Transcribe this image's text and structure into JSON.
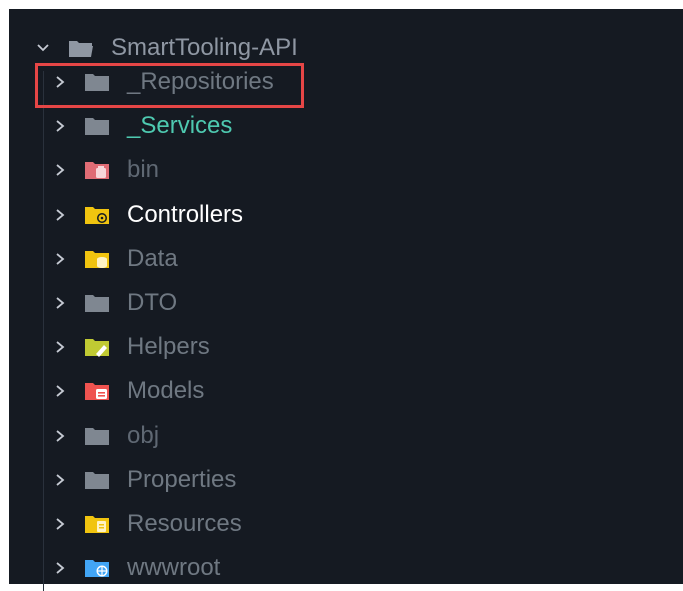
{
  "explorer": {
    "root": {
      "label": "SmartTooling-API",
      "expanded": true,
      "icon": "folder-open-icon",
      "color": "#8f97a3"
    },
    "folders": [
      {
        "id": "repositories",
        "label": "_Repositories",
        "color": "#6f7882",
        "icon_color": "#7f8791",
        "icon": "folder-icon",
        "highlighted": true
      },
      {
        "id": "services",
        "label": "_Services",
        "color": "#4ec9b0",
        "icon_color": "#7f8791",
        "icon": "folder-icon"
      },
      {
        "id": "bin",
        "label": "bin",
        "color": "#5f6873",
        "icon_color": "#e06c75",
        "icon": "folder-bin-icon"
      },
      {
        "id": "controllers",
        "label": "Controllers",
        "color": "#ffffff",
        "icon_color": "#f1c40f",
        "icon": "folder-controllers-icon"
      },
      {
        "id": "data",
        "label": "Data",
        "color": "#6f7882",
        "icon_color": "#f1c40f",
        "icon": "folder-database-icon"
      },
      {
        "id": "dto",
        "label": "DTO",
        "color": "#6f7882",
        "icon_color": "#7f8791",
        "icon": "folder-icon"
      },
      {
        "id": "helpers",
        "label": "Helpers",
        "color": "#6f7882",
        "icon_color": "#c0ca33",
        "icon": "folder-helper-icon"
      },
      {
        "id": "models",
        "label": "Models",
        "color": "#6f7882",
        "icon_color": "#ef5350",
        "icon": "folder-models-icon"
      },
      {
        "id": "obj",
        "label": "obj",
        "color": "#5f6873",
        "icon_color": "#7f8791",
        "icon": "folder-icon"
      },
      {
        "id": "properties",
        "label": "Properties",
        "color": "#6f7882",
        "icon_color": "#7f8791",
        "icon": "folder-icon"
      },
      {
        "id": "resources",
        "label": "Resources",
        "color": "#6f7882",
        "icon_color": "#f1c40f",
        "icon": "folder-resources-icon"
      },
      {
        "id": "wwwroot",
        "label": "wwwroot",
        "color": "#6f7882",
        "icon_color": "#42a5f5",
        "icon": "folder-web-icon"
      }
    ],
    "colors": {
      "background": "#151a22",
      "chevron": "#c5cad3",
      "highlight_border": "#e64646"
    }
  }
}
